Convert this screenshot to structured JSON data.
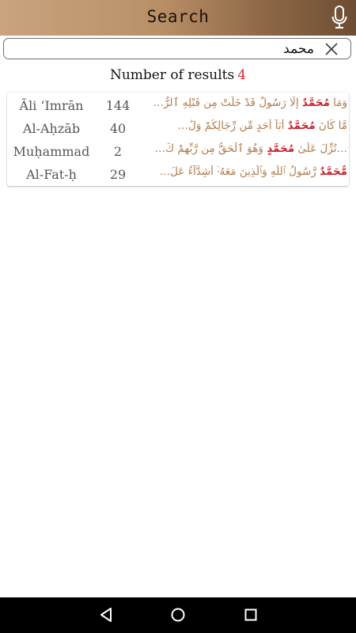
{
  "header": {
    "title": "Search"
  },
  "search": {
    "value": "محمد"
  },
  "results": {
    "label": "Number of results",
    "count": "4",
    "rows": [
      {
        "surah": "Āli ʻImrān",
        "ayah": "144",
        "verse_pre": "وَمَا ",
        "verse_match": "مُحَمَّدٌ",
        "verse_post": " إِلَّا رَسُولٌ قَدْ خَلَتْ مِن قَبْلِهِ ٱلرُّ…"
      },
      {
        "surah": "Al-Aḥzāb",
        "ayah": "40",
        "verse_pre": "مَّا كَانَ ",
        "verse_match": "مُحَمَّدٌ",
        "verse_post": " أَبَآ أَحَدٍ مِّن رِّجَالِكُمْ وَلَٰ…"
      },
      {
        "surah": "Muḥammad",
        "ayah": "2",
        "verse_pre": "…نُزِّلَ عَلَىٰ ",
        "verse_match": "مُحَمَّدٍ",
        "verse_post": " وَهُوَ ٱلْحَقُّ مِن رَّبِّهِمْ كَ…"
      },
      {
        "surah": "Al-Fat-ḥ",
        "ayah": "29",
        "verse_pre": "",
        "verse_match": "مُّحَمَّدٌ",
        "verse_post": " رَّسُولُ ٱللَّهِ وَٱلَّذِينَ مَعَهُۥٓ أَشِدَّآءُ عَلَ…"
      }
    ]
  },
  "icons": {
    "mic": "microphone-icon",
    "clear": "close-icon",
    "back": "nav-back-icon",
    "home": "nav-home-icon",
    "recents": "nav-recents-icon"
  },
  "colors": {
    "header_start": "#c9a47f",
    "header_end": "#6d4d33",
    "count": "#d4262a",
    "verse": "#b07c4e",
    "match": "#c8202a"
  }
}
